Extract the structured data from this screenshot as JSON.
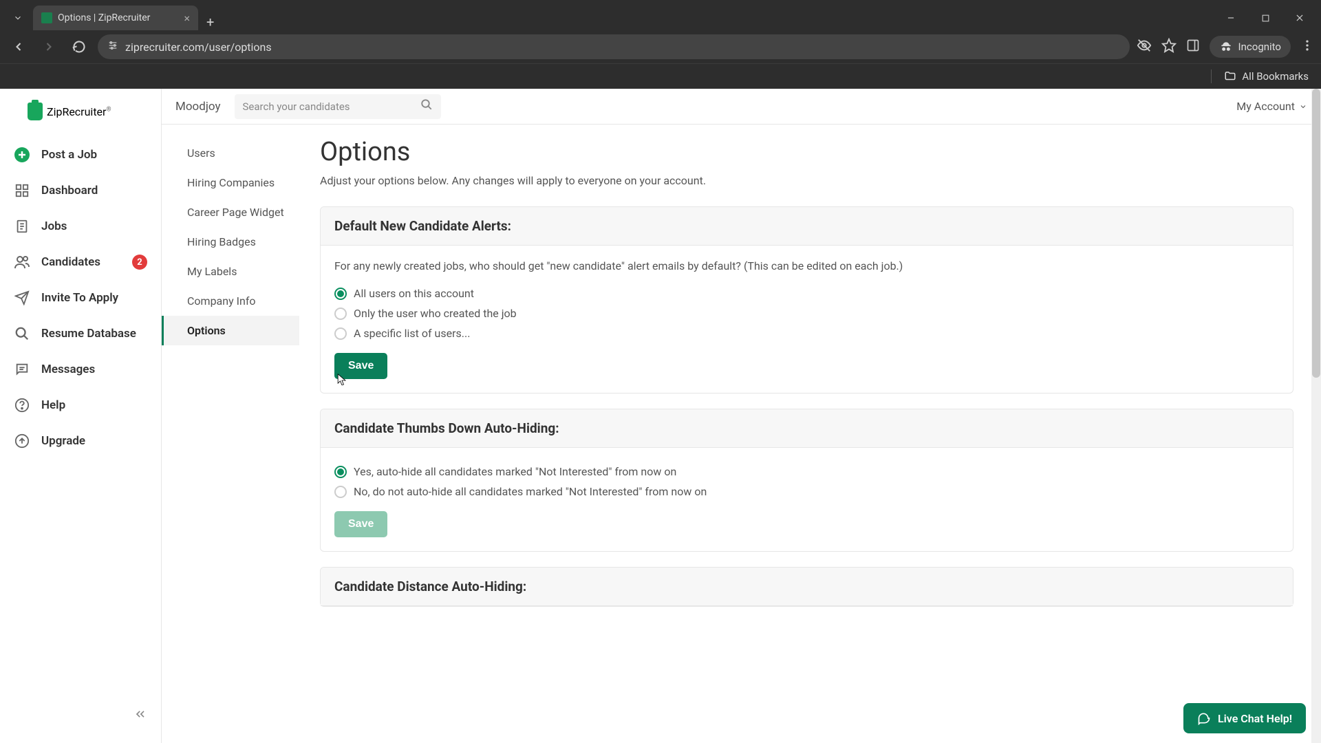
{
  "browser": {
    "tab_title": "Options | ZipRecruiter",
    "url": "ziprecruiter.com/user/options",
    "incognito_label": "Incognito",
    "all_bookmarks": "All Bookmarks"
  },
  "logo_text": "ZipRecruiter",
  "left_nav": [
    {
      "label": "Post a Job",
      "icon": "plus-circle"
    },
    {
      "label": "Dashboard",
      "icon": "grid"
    },
    {
      "label": "Jobs",
      "icon": "file"
    },
    {
      "label": "Candidates",
      "icon": "people",
      "badge": "2"
    },
    {
      "label": "Invite To Apply",
      "icon": "send"
    },
    {
      "label": "Resume Database",
      "icon": "search"
    },
    {
      "label": "Messages",
      "icon": "message"
    },
    {
      "label": "Help",
      "icon": "help"
    },
    {
      "label": "Upgrade",
      "icon": "upgrade"
    }
  ],
  "header": {
    "workspace": "Moodjoy",
    "search_placeholder": "Search your candidates",
    "account_label": "My Account"
  },
  "sub_nav": [
    {
      "label": "Users"
    },
    {
      "label": "Hiring Companies"
    },
    {
      "label": "Career Page Widget"
    },
    {
      "label": "Hiring Badges"
    },
    {
      "label": "My Labels"
    },
    {
      "label": "Company Info"
    },
    {
      "label": "Options",
      "active": true
    }
  ],
  "page": {
    "title": "Options",
    "subtitle": "Adjust your options below. Any changes will apply to everyone on your account."
  },
  "panels": {
    "alerts": {
      "title": "Default New Candidate Alerts:",
      "description": "For any newly created jobs, who should get \"new candidate\" alert emails by default? (This can be edited on each job.)",
      "options": [
        {
          "label": "All users on this account",
          "checked": true
        },
        {
          "label": "Only the user who created the job",
          "checked": false
        },
        {
          "label": "A specific list of users...",
          "checked": false
        }
      ],
      "save_label": "Save"
    },
    "autohide": {
      "title": "Candidate Thumbs Down Auto-Hiding:",
      "options": [
        {
          "label": "Yes, auto-hide all candidates marked \"Not Interested\" from now on",
          "checked": true
        },
        {
          "label": "No, do not auto-hide all candidates marked \"Not Interested\" from now on",
          "checked": false
        }
      ],
      "save_label": "Save"
    },
    "distance": {
      "title": "Candidate Distance Auto-Hiding:"
    }
  },
  "chat": {
    "label": "Live Chat Help!"
  }
}
